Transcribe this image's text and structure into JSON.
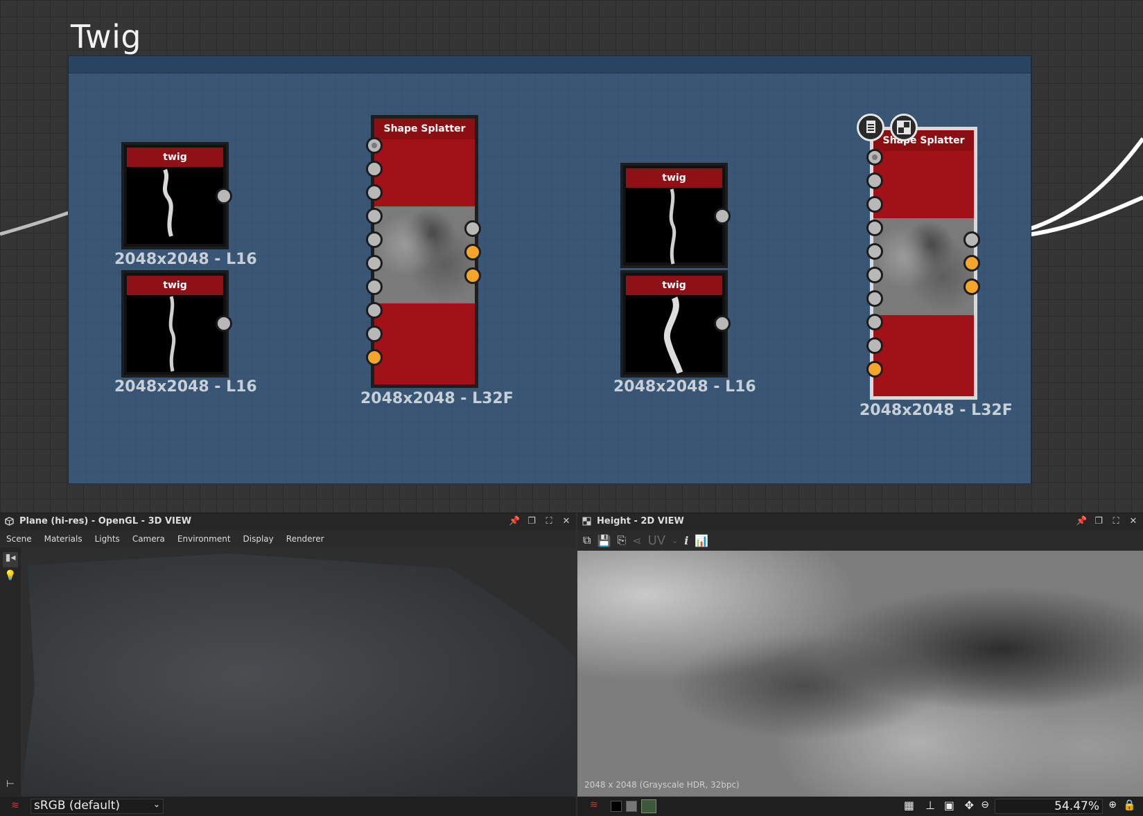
{
  "graph": {
    "frame_title": "Twig",
    "nodes": {
      "twig_a": {
        "title": "twig",
        "size": "2048x2048 - L16"
      },
      "twig_b": {
        "title": "twig",
        "size": "2048x2048 - L16"
      },
      "splatter_a": {
        "title": "Shape Splatter",
        "size": "2048x2048 - L32F"
      },
      "twig_c": {
        "title": "twig",
        "size": "2048x2048 - L16"
      },
      "twig_d": {
        "title": "twig",
        "size": "2048x2048 - L16"
      },
      "splatter_b": {
        "title": "Shape Splatter",
        "size": "2048x2048 - L32F"
      }
    },
    "node_icons": [
      "document-icon",
      "checker-icon"
    ]
  },
  "view3d": {
    "title": "Plane (hi-res) - OpenGL - 3D VIEW",
    "menu": [
      "Scene",
      "Materials",
      "Lights",
      "Camera",
      "Environment",
      "Display",
      "Renderer"
    ],
    "colorspace": "sRGB (default)"
  },
  "view2d": {
    "title": "Height - 2D VIEW",
    "uv_label": "UV",
    "info_label": "i",
    "image_info": "2048 x 2048 (Grayscale HDR, 32bpc)",
    "zoom": "54.47%"
  },
  "colors": {
    "frame": "#3a5675",
    "node_header": "#8f1015",
    "port_orange": "#f4a62a"
  }
}
